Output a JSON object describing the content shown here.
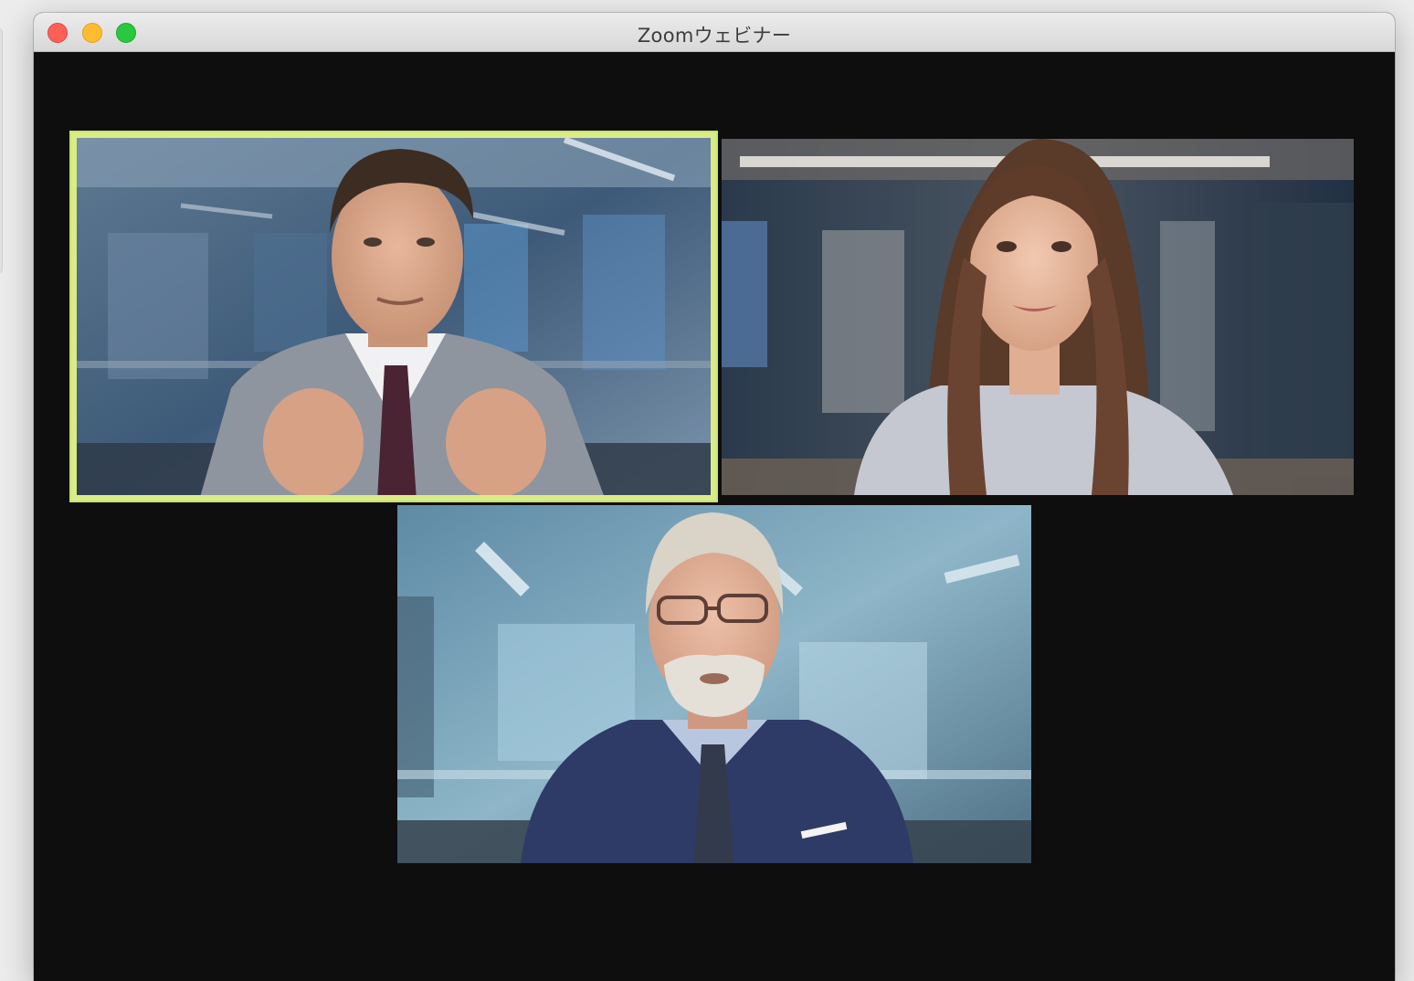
{
  "window": {
    "title": "Zoomウェビナー"
  },
  "gallery": {
    "active_speaker_color": "#d9ec88",
    "participants": [
      {
        "id": "participant-1",
        "speaking": true
      },
      {
        "id": "participant-2",
        "speaking": false
      },
      {
        "id": "participant-3",
        "speaking": false
      }
    ]
  }
}
